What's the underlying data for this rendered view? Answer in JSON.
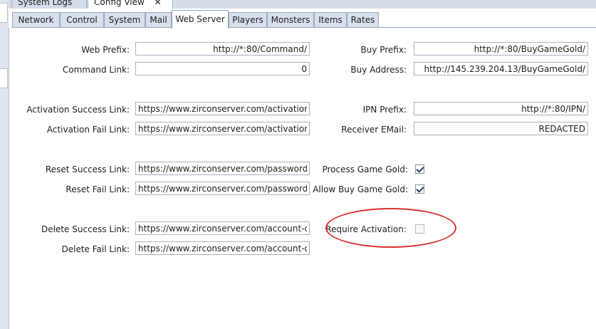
{
  "document_tabs": {
    "system_logs": "System Logs",
    "config_view": "Config View",
    "close_glyph": "✕"
  },
  "tabs": [
    "Network",
    "Control",
    "System",
    "Mail",
    "Web Server",
    "Players",
    "Monsters",
    "Items",
    "Rates"
  ],
  "active_tab": "Web Server",
  "fields": {
    "web_prefix": {
      "label": "Web Prefix:",
      "value": "http://*:80/Command/"
    },
    "command_link": {
      "label": "Command Link:",
      "value": "0"
    },
    "activation_success_link": {
      "label": "Activation Success Link:",
      "value": "https://www.zirconserver.com/activation-success"
    },
    "activation_fail_link": {
      "label": "Activation Fail Link:",
      "value": "https://www.zirconserver.com/activation-unsuccessful"
    },
    "reset_success_link": {
      "label": "Reset Success Link:",
      "value": "https://www.zirconserver.com/password-reset-success"
    },
    "reset_fail_link": {
      "label": "Reset Fail Link:",
      "value": "https://www.zirconserver.com/password-reset-unsuccessful"
    },
    "delete_success_link": {
      "label": "Delete Success Link:",
      "value": "https://www.zirconserver.com/account-deleted"
    },
    "delete_fail_link": {
      "label": "Delete Fail Link:",
      "value": "https://www.zirconserver.com/account-delete-fail"
    },
    "buy_prefix": {
      "label": "Buy Prefix:",
      "value": "http://*:80/BuyGameGold/"
    },
    "buy_address": {
      "label": "Buy Address:",
      "value": "http://145.239.204.13/BuyGameGold/"
    },
    "ipn_prefix": {
      "label": "IPN Prefix:",
      "value": "http://*:80/IPN/"
    },
    "receiver_email": {
      "label": "Receiver EMail:",
      "value": "REDACTED"
    }
  },
  "checkboxes": {
    "process_game_gold": {
      "label": "Process Game Gold:",
      "checked": true
    },
    "allow_buy_game_gold": {
      "label": "Allow Buy Game Gold:",
      "checked": true
    },
    "require_activation": {
      "label": "Require Activation:",
      "checked": false
    }
  },
  "colors": {
    "annotation": "#d9302c",
    "tab_inactive": "#d8e0ec",
    "tab_border": "#99abc4"
  }
}
